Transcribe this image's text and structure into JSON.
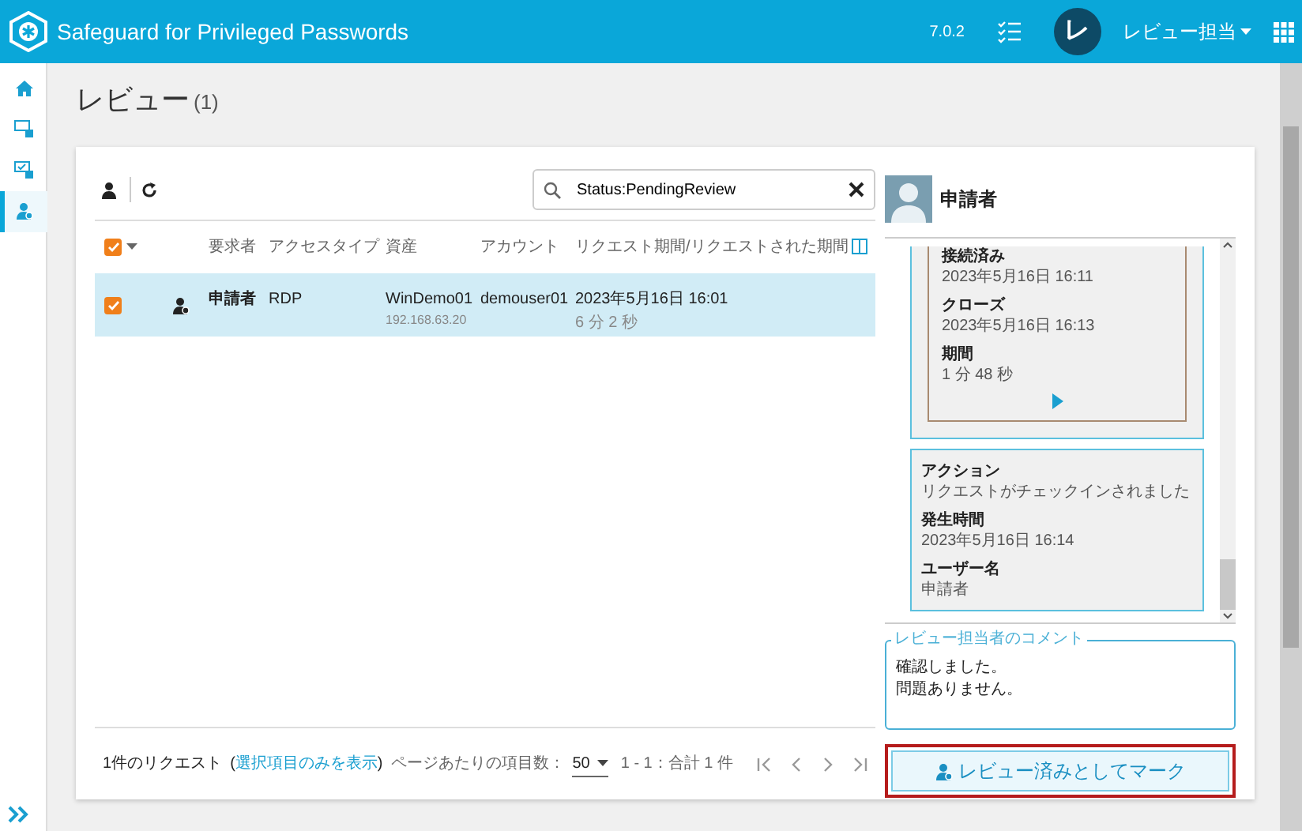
{
  "app": {
    "title": "Safeguard for Privileged Passwords",
    "version": "7.0.2",
    "user_initial": "レ",
    "user_name": "レビュー担当"
  },
  "sidebar": {
    "items": [
      {
        "kind": "home",
        "selected": false
      },
      {
        "kind": "asset",
        "selected": false
      },
      {
        "kind": "approve",
        "selected": false
      },
      {
        "kind": "review",
        "selected": true
      }
    ]
  },
  "page": {
    "title": "レビュー",
    "count": "(1)"
  },
  "toolbar": {
    "search": "Status:PendingReview"
  },
  "table": {
    "select_all_checked": true,
    "columns": [
      "要求者",
      "アクセスタイプ",
      "資産",
      "アカウント",
      "リクエスト期間/リクエストされた期間"
    ],
    "rows": [
      {
        "selected": true,
        "checked": true,
        "requester": "申請者",
        "access_type": "RDP",
        "asset": "WinDemo01",
        "asset_ip": "192.168.63.20",
        "account": "demouser01",
        "request_time": "2023年5月16日 16:01",
        "duration": "6 分 2 秒"
      }
    ]
  },
  "footer": {
    "count": "1件のリクエスト",
    "note_before": "(",
    "link": "選択項目のみを表示",
    "note_after": ")",
    "per_page_label": "ページあたりの項目数：",
    "per_page": "50",
    "range": "1 - 1：合計 1 件"
  },
  "detail": {
    "name": "申請者",
    "session": [
      {
        "label": "接続済み",
        "value": "2023年5月16日 16:11"
      },
      {
        "label": "クローズ",
        "value": "2023年5月16日 16:13"
      },
      {
        "label": "期間",
        "value": "1 分 48 秒"
      }
    ],
    "action": [
      {
        "label": "アクション",
        "value": "リクエストがチェックインされました"
      },
      {
        "label": "発生時間",
        "value": "2023年5月16日 16:14"
      },
      {
        "label": "ユーザー名",
        "value": "申請者"
      }
    ],
    "comment_label": "レビュー担当者のコメント",
    "comment": [
      "確認しました。",
      "問題ありません。"
    ],
    "button": "レビュー済みとしてマーク"
  }
}
